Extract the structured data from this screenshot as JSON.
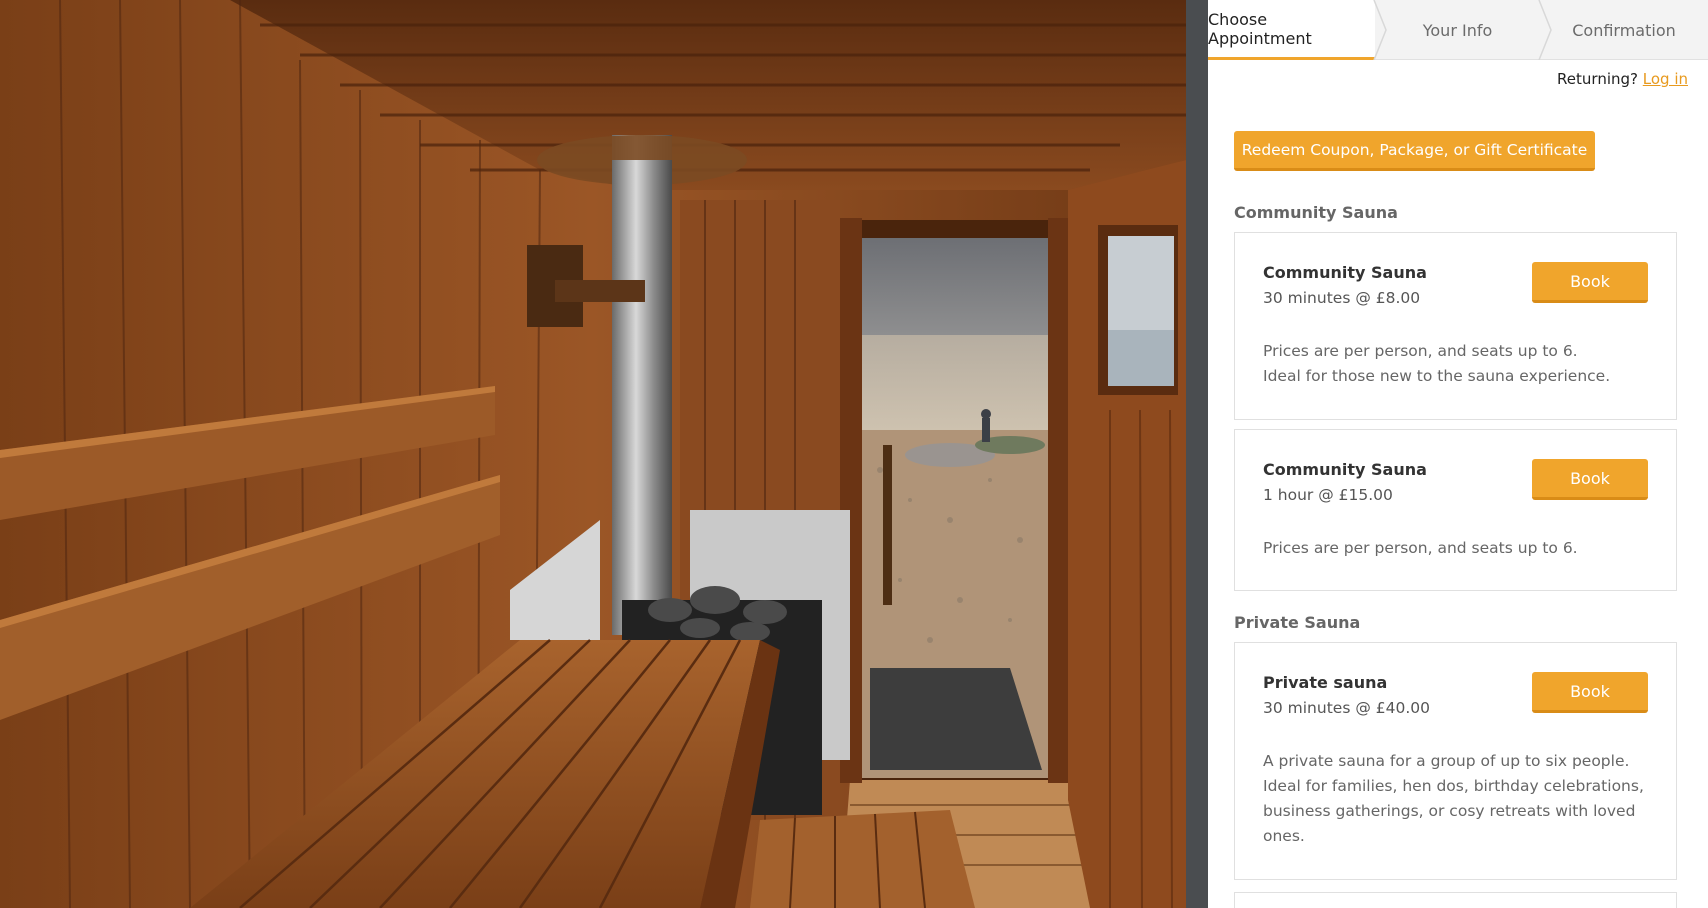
{
  "steps": [
    "Choose Appointment",
    "Your Info",
    "Confirmation"
  ],
  "returning": {
    "text": "Returning?",
    "login_label": "Log in"
  },
  "coupon_label": "Redeem Coupon, Package, or Gift Certificate",
  "categories": [
    {
      "name": "Community Sauna",
      "services": [
        {
          "title": "Community Sauna",
          "subtitle": "30 minutes @ £8.00",
          "desc_lines": [
            "Prices are per person, and seats up to 6.",
            "Ideal for those new to the sauna experience."
          ],
          "book_label": "Book"
        },
        {
          "title": "Community Sauna",
          "subtitle": "1 hour @ £15.00",
          "desc_lines": [
            "Prices are per person, and seats up to 6."
          ],
          "book_label": "Book"
        }
      ]
    },
    {
      "name": "Private Sauna",
      "services": [
        {
          "title": "Private sauna",
          "subtitle": "30 minutes @ £40.00",
          "desc_lines": [
            "A private sauna for a group of up to six people.",
            "Ideal for families, hen dos, birthday celebrations,",
            "business gatherings, or cosy retreats with loved",
            "ones."
          ],
          "book_label": "Book"
        }
      ]
    }
  ],
  "colors": {
    "accent": "#f0a52c",
    "accent_dark": "#d98c17",
    "link": "#e89a1e"
  },
  "icons": {
    "step_separator": "chevron-right-icon"
  }
}
